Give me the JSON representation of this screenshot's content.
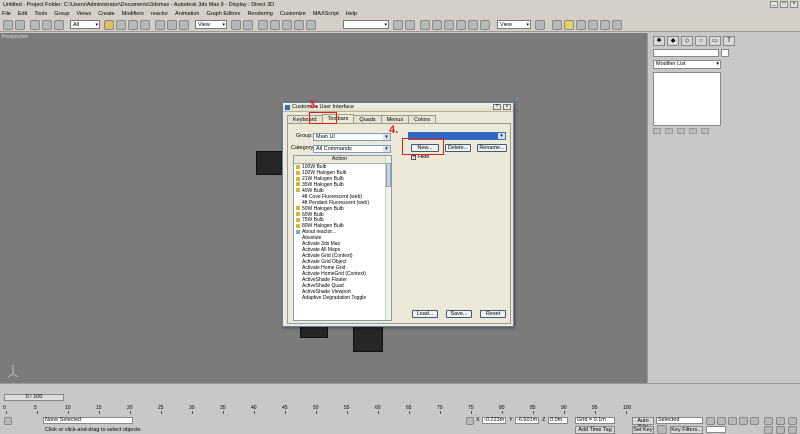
{
  "app": {
    "title": "Untitled    - Project Folder: C:\\Users\\Administrator\\Documents\\3dsmax    - Autodesk 3ds Max 9    - Display : Direct 3D"
  },
  "menu": [
    "File",
    "Edit",
    "Tools",
    "Group",
    "Views",
    "Create",
    "Modifiers",
    "reactor",
    "Animation",
    "Graph Editors",
    "Rendering",
    "Customize",
    "MAXScript",
    "Help"
  ],
  "toolbar": {
    "selection_filter": "All",
    "ref_coord": "View",
    "named_sel": "",
    "view_dropdown": "View"
  },
  "viewport": {
    "label": "Perspective"
  },
  "command_panel": {
    "modifier_list": "Modifier List"
  },
  "timeline": {
    "slider": "0 / 100",
    "ticks": [
      "0",
      "5",
      "10",
      "15",
      "20",
      "25",
      "30",
      "35",
      "40",
      "45",
      "50",
      "55",
      "60",
      "65",
      "70",
      "75",
      "80",
      "85",
      "90",
      "95",
      "100"
    ]
  },
  "status": {
    "selection": "None Selected",
    "prompt": "Click or click-and-drag to select objects",
    "x": "-0.223m",
    "y": "-6.601m",
    "z": "0.0m",
    "grid": "Grid = 0.1m",
    "add_time_tag": "Add Time Tag",
    "auto_key": "Auto Key",
    "selected": "Selected",
    "set_key": "Set Key",
    "key_filters": "Key Filters..."
  },
  "dialog": {
    "title": "Customize User Interface",
    "tabs": [
      "Keyboard",
      "Toolbars",
      "Quads",
      "Menus",
      "Colors"
    ],
    "active_tab": "Toolbars",
    "group_label": "Group:",
    "group_value": "Main UI",
    "category_label": "Category:",
    "category_value": "All Commands",
    "list_header": "Action",
    "actions": [
      {
        "icon": "bulb",
        "label": "100W Bulb"
      },
      {
        "icon": "bulb",
        "label": "100W Halogen Bulb"
      },
      {
        "icon": "bulb",
        "label": "21W Halogen Bulb"
      },
      {
        "icon": "bulb",
        "label": "35W Halogen Bulb"
      },
      {
        "icon": "bulb",
        "label": "40W Bulb"
      },
      {
        "icon": "none",
        "label": "4ft Cove Fluorescent (web)"
      },
      {
        "icon": "none",
        "label": "4ft Pendant Fluorescent (web)"
      },
      {
        "icon": "bulb",
        "label": "50W Halogen Bulb"
      },
      {
        "icon": "bulb",
        "label": "60W Bulb"
      },
      {
        "icon": "bulb",
        "label": "75W Bulb"
      },
      {
        "icon": "bulb",
        "label": "80W Halogen Bulb"
      },
      {
        "icon": "box",
        "label": "About reactor..."
      },
      {
        "icon": "none",
        "label": "Absolute"
      },
      {
        "icon": "none",
        "label": "Activate 3ds Max"
      },
      {
        "icon": "none",
        "label": "Activate All Maps"
      },
      {
        "icon": "none",
        "label": "Activate Grid (Context)"
      },
      {
        "icon": "none",
        "label": "Activate Grid Object"
      },
      {
        "icon": "none",
        "label": "Activate Home Grid"
      },
      {
        "icon": "none",
        "label": "Activate HomeGrid (Context)"
      },
      {
        "icon": "none",
        "label": "ActiveShade Floater"
      },
      {
        "icon": "none",
        "label": "ActiveShade Quad"
      },
      {
        "icon": "none",
        "label": "ActiveShade Viewport"
      },
      {
        "icon": "none",
        "label": "Adaptive Degradation Toggle"
      }
    ],
    "toolbar_combo": "",
    "new_button": "New...",
    "delete_button": "Delete...",
    "rename_button": "Rename...",
    "hide_label": "Hide",
    "load_button": "Load...",
    "save_button": "Save...",
    "reset_button": "Reset"
  },
  "annotations": {
    "step3": "3.",
    "step4": "4."
  }
}
